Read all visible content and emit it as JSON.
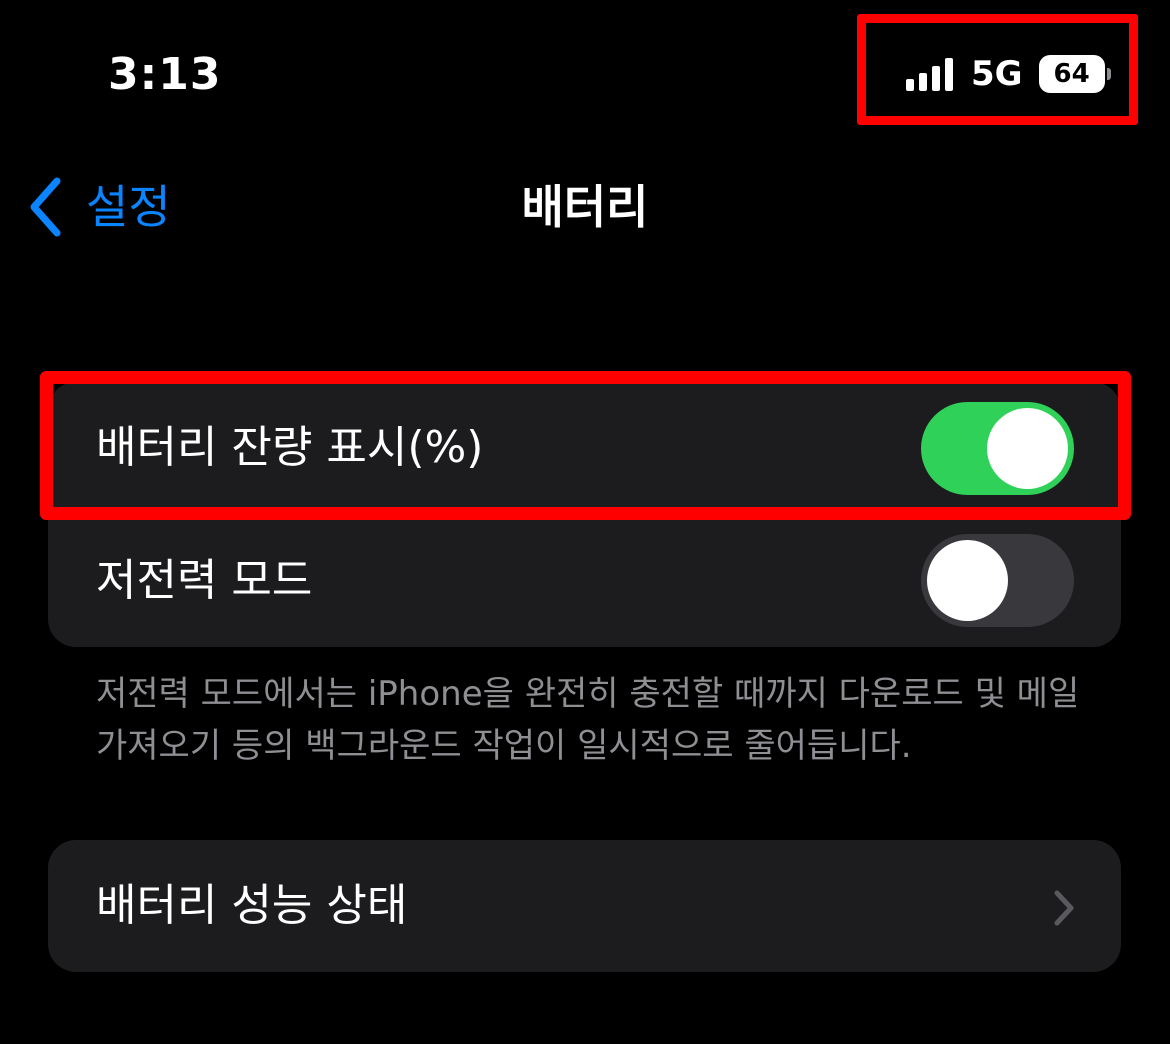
{
  "status_bar": {
    "time": "3:13",
    "network": "5G",
    "battery_level": "64",
    "signal_bars": 4
  },
  "nav": {
    "back_label": "설정",
    "title": "배터리"
  },
  "settings": {
    "battery_percentage": {
      "label": "배터리 잔량 표시(%)",
      "enabled": true
    },
    "low_power_mode": {
      "label": "저전력 모드",
      "enabled": false
    },
    "low_power_footer": "저전력 모드에서는 iPhone을 완전히 충전할 때까지 다운로드 및 메일 가져오기 등의 백그라운드 작업이 일시적으로 줄어듭니다.",
    "battery_health": {
      "label": "배터리 성능 상태"
    }
  },
  "colors": {
    "background": "#000000",
    "cell": "#1c1c1e",
    "accent": "#0a84ff",
    "toggle_on": "#30d158",
    "toggle_off": "#39393d",
    "highlight": "#ff0000",
    "secondary_text": "#8e8e93"
  }
}
